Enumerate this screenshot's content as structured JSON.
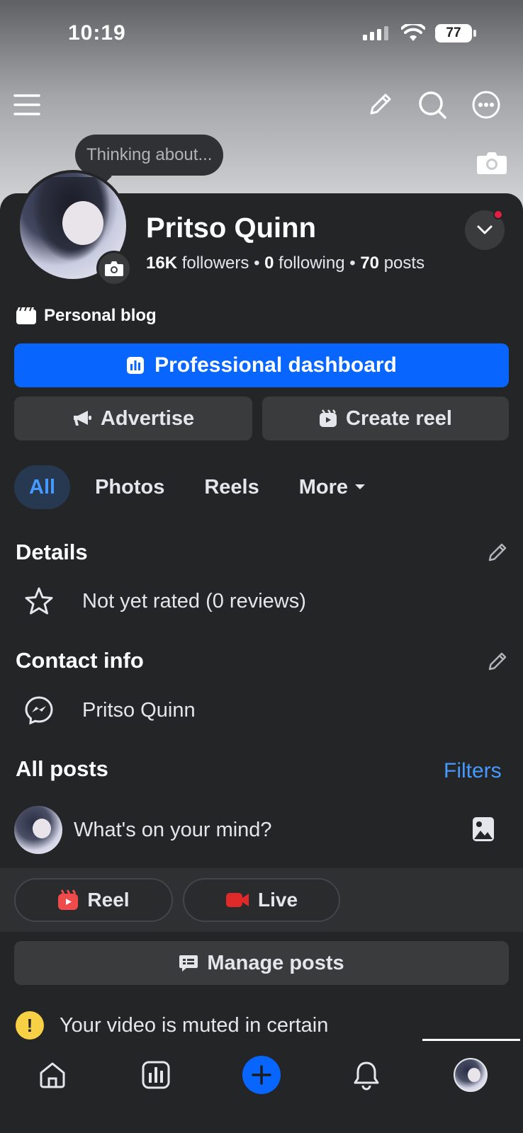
{
  "status_bar": {
    "time": "10:19",
    "battery": "77"
  },
  "header": {
    "thought_bubble": "Thinking about...",
    "icons": [
      "menu-icon",
      "pencil-icon",
      "search-icon",
      "more-icon",
      "camera-icon"
    ]
  },
  "profile": {
    "name": "Pritso Quinn",
    "followers_count": "16K",
    "followers_label": " followers",
    "sep1": " • ",
    "following_count": "0",
    "following_label": " following",
    "sep2": " • ",
    "posts_count": "70",
    "posts_label": " posts",
    "category": "Personal blog"
  },
  "actions": {
    "professional_dashboard": "Professional dashboard",
    "advertise": "Advertise",
    "create_reel": "Create reel"
  },
  "tabs": [
    {
      "label": "All",
      "active": true
    },
    {
      "label": "Photos",
      "active": false
    },
    {
      "label": "Reels",
      "active": false
    },
    {
      "label": "More",
      "active": false
    }
  ],
  "details": {
    "title": "Details",
    "rating": "Not yet rated (0 reviews)"
  },
  "contact": {
    "title": "Contact info",
    "messenger": "Pritso Quinn"
  },
  "posts": {
    "title": "All posts",
    "filters": "Filters",
    "composer_placeholder": "What's on your mind?",
    "reel_label": "Reel",
    "live_label": "Live",
    "manage_posts": "Manage posts",
    "notice": "Your video is muted in certain"
  },
  "colors": {
    "accent": "#0866ff",
    "link": "#4599ff",
    "background": "#242527",
    "reel": "#ef4b4b",
    "live": "#e02a2a",
    "warning": "#f7d046"
  },
  "bottom_nav": [
    "home-icon",
    "dashboard-icon",
    "create-icon",
    "notifications-icon",
    "profile-avatar"
  ]
}
